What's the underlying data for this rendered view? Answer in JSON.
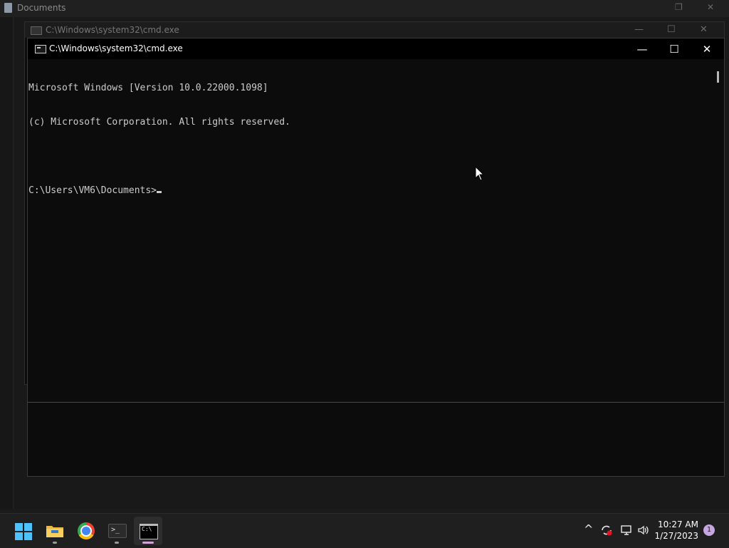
{
  "explorer": {
    "title": "Documents"
  },
  "cmd_back": {
    "title": "C:\\Windows\\system32\\cmd.exe"
  },
  "cmd_front": {
    "title": "C:\\Windows\\system32\\cmd.exe",
    "lines": [
      "Microsoft Windows [Version 10.0.22000.1098]",
      "(c) Microsoft Corporation. All rights reserved.",
      "",
      "C:\\Users\\VM6\\Documents>"
    ]
  },
  "window_controls": {
    "minimize": "—",
    "maximize": "☐",
    "close": "✕"
  },
  "taskbar": {
    "apps": [
      {
        "name": "start",
        "icon": "windows-logo-icon"
      },
      {
        "name": "file-explorer",
        "icon": "folder-icon"
      },
      {
        "name": "chrome",
        "icon": "chrome-icon"
      },
      {
        "name": "terminal",
        "icon": "terminal-icon"
      },
      {
        "name": "command-prompt",
        "icon": "cmd-icon",
        "active": true
      }
    ],
    "tray": {
      "chevron": "^",
      "time": "10:27 AM",
      "date": "1/27/2023",
      "notification_count": "1"
    }
  },
  "colors": {
    "console_bg": "#0c0c0c",
    "console_text": "#cccccc",
    "accent": "#4cc2ff",
    "active_indicator": "#d9a2d6"
  }
}
